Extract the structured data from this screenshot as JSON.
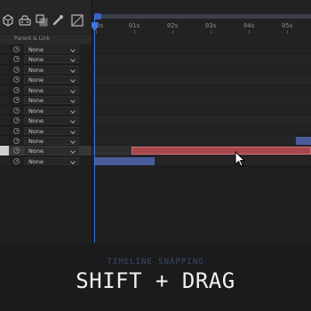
{
  "colors": {
    "playhead": "#3d74e2",
    "bar_red": "#a8484e",
    "bar_blue": "#4a5c9a",
    "background": "#1f1f21",
    "caption_sub": "#3a4a68",
    "caption_main": "#f2f2f2"
  },
  "toolbar": {
    "icons": [
      "composition-mini-flowchart-icon",
      "draft-3d-icon",
      "frame-blending-icon",
      "motion-blur-icon",
      "graph-editor-icon"
    ]
  },
  "ruler": {
    "ticks": [
      "0s",
      "01s",
      "02s",
      "03s",
      "04s",
      "05s"
    ]
  },
  "columns": {
    "parent_link": "Parent & Link"
  },
  "layers": [
    {
      "parent": "None"
    },
    {
      "parent": "None"
    },
    {
      "parent": "None"
    },
    {
      "parent": "None"
    },
    {
      "parent": "None"
    },
    {
      "parent": "None"
    },
    {
      "parent": "None"
    },
    {
      "parent": "None"
    },
    {
      "parent": "None"
    },
    {
      "parent": "None"
    },
    {
      "parent": "None"
    },
    {
      "parent": "None"
    }
  ],
  "selected_layer_index": 10,
  "caption": {
    "subtitle": "TIMELINE SNAPPING",
    "title": "SHIFT + DRAG"
  }
}
